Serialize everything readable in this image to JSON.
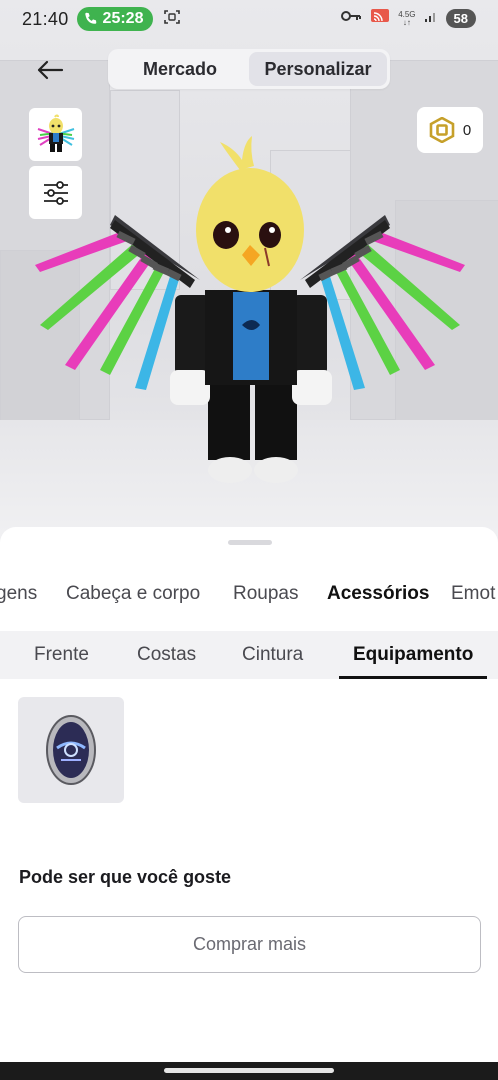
{
  "status_bar": {
    "time": "21:40",
    "call_timer": "25:28",
    "network_label": "4.5G",
    "battery": "58"
  },
  "header": {
    "tabs": [
      {
        "label": "Mercado",
        "active": false
      },
      {
        "label": "Personalizar",
        "active": true
      }
    ],
    "robux_balance": "0"
  },
  "category_tabs": [
    {
      "label": "gens",
      "active": false
    },
    {
      "label": "Cabeça e corpo",
      "active": false
    },
    {
      "label": "Roupas",
      "active": false
    },
    {
      "label": "Acessórios",
      "active": true
    },
    {
      "label": "Emot",
      "active": false
    }
  ],
  "sub_tabs": [
    {
      "label": "Frente",
      "active": false
    },
    {
      "label": "Costas",
      "active": false
    },
    {
      "label": "Cintura",
      "active": false
    },
    {
      "label": "Equipamento",
      "active": true
    }
  ],
  "items": [
    {
      "icon": "grey-egg-item-icon"
    }
  ],
  "recommend": {
    "title": "Pode ser que você goste",
    "button_label": "Comprar mais"
  },
  "colors": {
    "call_green": "#3fb34f",
    "selected_segment": "#e2e2e8",
    "sheet_background": "#ffffff"
  }
}
